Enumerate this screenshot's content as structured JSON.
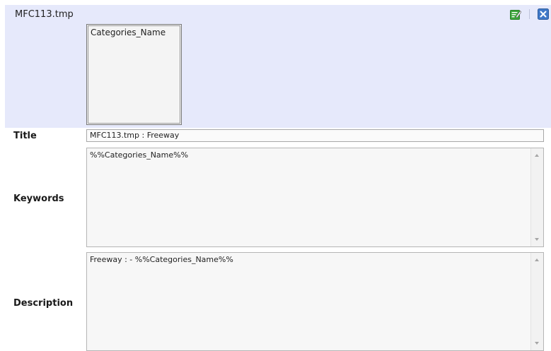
{
  "header": {
    "file_name": "MFC113.tmp",
    "edit_icon": "edit-icon",
    "close_icon": "close-icon",
    "accent_colors": {
      "panel": "#e6e9fb",
      "edit": "#3aa63a",
      "close": "#3f78c8"
    }
  },
  "categories_list": {
    "items": [
      "Categories_Name"
    ]
  },
  "fields": {
    "title": {
      "label": "Title",
      "value": "MFC113.tmp : Freeway"
    },
    "keywords": {
      "label": "Keywords",
      "value": "%%Categories_Name%%"
    },
    "description": {
      "label": "Description",
      "value": "Freeway : - %%Categories_Name%%"
    }
  }
}
